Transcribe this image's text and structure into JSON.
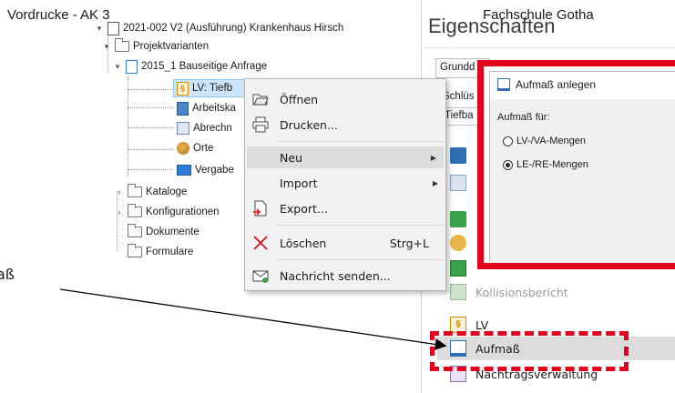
{
  "header": {
    "left_title": "Vordrucke - AK 3",
    "right_title": "Fachschule Gotha",
    "panel_title": "Eigenschaften"
  },
  "tree": {
    "root": "2021-002 V2 (Ausführung) Krankenhaus Hirsch",
    "projektvarianten": "Projektvarianten",
    "variante": "2015_1 Bauseitige Anfrage",
    "lv": "LV: Tiefb",
    "arbeits": "Arbeitska",
    "abrechn": "Abrechn",
    "orte": "Orte",
    "vergabe": "Vergabe",
    "kataloge": "Kataloge",
    "konfigurationen": "Konfigurationen",
    "dokumente": "Dokumente",
    "formulare": "Formulare"
  },
  "context_menu": {
    "items": [
      {
        "label": "Öffnen",
        "icon": "folder-open-icon"
      },
      {
        "label": "Drucken...",
        "icon": "printer-icon"
      },
      {
        "label": "Neu",
        "icon": "",
        "submenu": true
      },
      {
        "label": "Import",
        "icon": "",
        "submenu": true
      },
      {
        "label": "Export...",
        "icon": "export-icon"
      },
      {
        "label": "Löschen",
        "icon": "delete-x-icon",
        "shortcut": "Strg+L"
      },
      {
        "label": "Nachricht senden...",
        "icon": "envelope-icon"
      }
    ]
  },
  "properties": {
    "tab1": "Grundd",
    "field1": "Schlüs",
    "field2": "Tiefba"
  },
  "dialog": {
    "title": "Aufmaß anlegen",
    "section": "Aufmaß für:",
    "option1": "LV-/VA-Mengen",
    "option2": "LE-/RE-Mengen",
    "selected": "LE-/RE-Mengen"
  },
  "ribbon": {
    "kollisionsbericht": "Kollisionsbericht",
    "lv": "LV",
    "aufmass": "Aufmaß",
    "nachtrags": "Nachtragsverwaltung"
  },
  "callout": {
    "label": "aß"
  },
  "colors": {
    "highlight_red": "#e3001b",
    "selection_blue": "#cce4f7",
    "menu_bg": "#f2f2f2"
  }
}
